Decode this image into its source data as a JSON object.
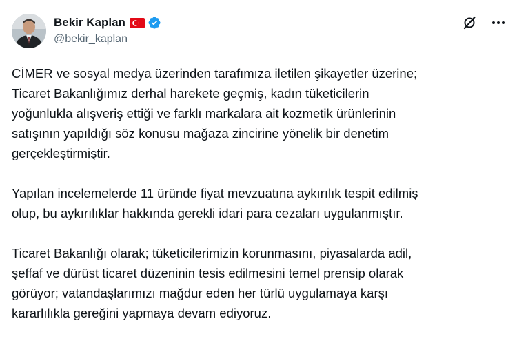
{
  "post": {
    "author": {
      "display_name": "Bekir Kaplan",
      "handle": "@bekir_kaplan",
      "flag_icon": "turkey-flag-icon",
      "verified_icon": "verified-badge-icon",
      "verified_color": "#1d9bf0"
    },
    "actions": {
      "grok_icon": "grok-icon",
      "more_icon": "more-options-icon"
    },
    "paragraphs": [
      {
        "lines": [
          "CİMER ve sosyal medya üzerinden tarafımıza iletilen şikayetler üzerine;",
          "Ticaret Bakanlığımız derhal harekete geçmiş, kadın tüketicilerin",
          "yoğunlukla alışveriş ettiği ve farklı markalara ait kozmetik ürünlerinin",
          "satışının yapıldığı söz konusu mağaza zincirine yönelik bir denetim",
          "gerçekleştirmiştir."
        ]
      },
      {
        "lines": [
          "Yapılan incelemelerde 11 üründe fiyat mevzuatına aykırılık tespit edilmiş",
          "olup, bu aykırılıklar hakkında gerekli idari para cezaları uygulanmıştır."
        ]
      },
      {
        "lines": [
          "Ticaret Bakanlığı olarak; tüketicilerimizin korunmasını, piyasalarda adil,",
          "şeffaf ve dürüst ticaret düzeninin tesis edilmesini temel prensip olarak",
          "görüyor; vatandaşlarımızı mağdur eden her türlü uygulamaya karşı",
          "kararlılıkla gereğini yapmaya devam ediyoruz."
        ]
      }
    ]
  }
}
